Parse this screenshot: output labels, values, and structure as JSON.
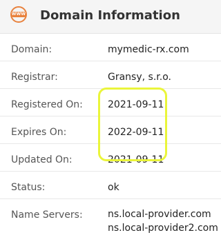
{
  "header": {
    "icon_text": "WWW",
    "title": "Domain Information"
  },
  "rows": [
    {
      "label": "Domain:",
      "value": "mymedic-rx.com"
    },
    {
      "label": "Registrar:",
      "value": "Gransy, s.r.o."
    },
    {
      "label": "Registered On:",
      "value": "2021-09-11"
    },
    {
      "label": "Expires On:",
      "value": "2022-09-11"
    },
    {
      "label": "Updated On:",
      "value": "2021-09-11"
    },
    {
      "label": "Status:",
      "value": "ok"
    },
    {
      "label": "Name Servers:",
      "values": [
        "ns.local-provider.com",
        "ns.local-provider2.com"
      ]
    }
  ],
  "colors": {
    "icon": "#e8813c",
    "highlight": "#eaf53a"
  }
}
